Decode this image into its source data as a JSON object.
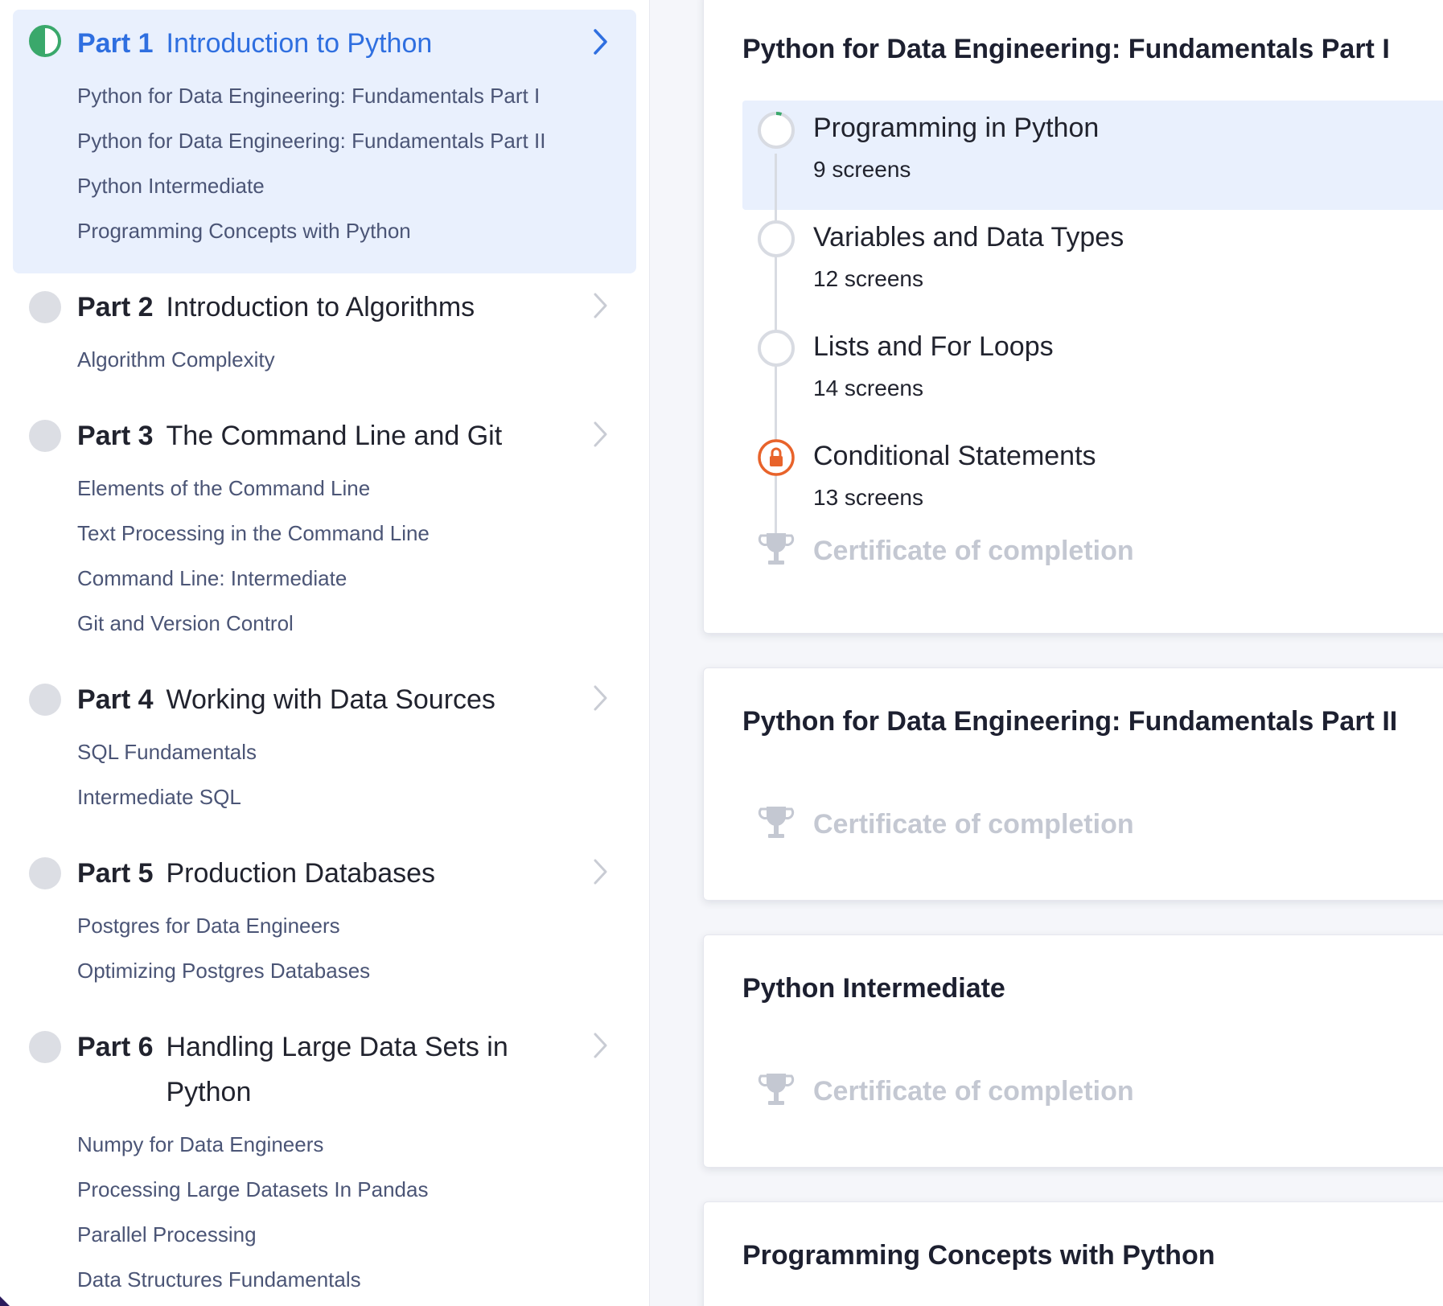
{
  "sidebar": {
    "parts": [
      {
        "number": "Part 1",
        "title": "Introduction to Python",
        "status": "in-progress",
        "active": true,
        "courses": [
          "Python for Data Engineering: Fundamentals Part I",
          "Python for Data Engineering: Fundamentals Part II",
          "Python Intermediate",
          "Programming Concepts with Python"
        ]
      },
      {
        "number": "Part 2",
        "title": "Introduction to Algorithms",
        "status": "not-started",
        "courses": [
          "Algorithm Complexity"
        ]
      },
      {
        "number": "Part 3",
        "title": "The Command Line and Git",
        "status": "not-started",
        "courses": [
          "Elements of the Command Line",
          "Text Processing in the Command Line",
          "Command Line: Intermediate",
          "Git and Version Control"
        ]
      },
      {
        "number": "Part 4",
        "title": "Working with Data Sources",
        "status": "not-started",
        "courses": [
          "SQL Fundamentals",
          "Intermediate SQL"
        ]
      },
      {
        "number": "Part 5",
        "title": "Production Databases",
        "status": "not-started",
        "courses": [
          "Postgres for Data Engineers",
          "Optimizing Postgres Databases"
        ]
      },
      {
        "number": "Part 6",
        "title": "Handling Large Data Sets in Python",
        "status": "not-started",
        "courses": [
          "Numpy for Data Engineers",
          "Processing Large Datasets In Pandas",
          "Parallel Processing",
          "Data Structures Fundamentals"
        ]
      }
    ]
  },
  "main": {
    "courses": [
      {
        "title": "Python for Data Engineering: Fundamentals Part I",
        "lessons": [
          {
            "title": "Programming in Python",
            "meta": "9 screens",
            "status": "in-progress",
            "progress": 0.05,
            "highlighted": true
          },
          {
            "title": "Variables and Data Types",
            "meta": "12 screens",
            "status": "not-started"
          },
          {
            "title": "Lists and For Loops",
            "meta": "14 screens",
            "status": "not-started"
          },
          {
            "title": "Conditional Statements",
            "meta": "13 screens",
            "status": "locked"
          }
        ],
        "certificate": "Certificate of completion"
      },
      {
        "title": "Python for Data Engineering: Fundamentals Part II",
        "lessons": [],
        "certificate": "Certificate of completion"
      },
      {
        "title": "Python Intermediate",
        "lessons": [],
        "certificate": "Certificate of completion"
      },
      {
        "title": "Programming Concepts with Python",
        "lessons": [],
        "certificate": ""
      }
    ]
  },
  "icons": {
    "part_status": "progress-circle-icon",
    "chevron": "chevron-right-icon",
    "lesson_node": "progress-ring-icon",
    "lock": "lock-icon",
    "certificate": "trophy-icon"
  },
  "colors": {
    "accent_blue": "#2f6fe0",
    "active_bg": "#e9f0fd",
    "progress_green": "#3aa86b",
    "lock_orange": "#e8632b",
    "muted_text": "#4b5576",
    "certificate_gray": "#c4c8d2"
  }
}
